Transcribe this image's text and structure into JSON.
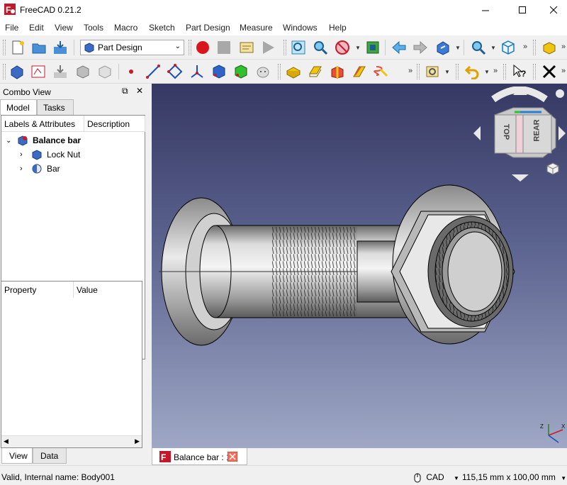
{
  "window": {
    "title": "FreeCAD 0.21.2"
  },
  "menu": [
    "File",
    "Edit",
    "View",
    "Tools",
    "Macro",
    "Sketch",
    "Part Design",
    "Measure",
    "Windows",
    "Help"
  ],
  "toolbar": {
    "workbench": "Part Design"
  },
  "combo_view": {
    "title": "Combo View",
    "tabs": [
      "Model",
      "Tasks"
    ],
    "tree_headers": [
      "Labels & Attributes",
      "Description"
    ],
    "tree": {
      "root": "Balance bar",
      "children": [
        "Lock Nut",
        "Bar"
      ]
    },
    "property_headers": [
      "Property",
      "Value"
    ],
    "bottom_tabs": [
      "View",
      "Data"
    ]
  },
  "document_tab": {
    "label": "Balance bar : 1"
  },
  "navcube": {
    "face_top": "TOP",
    "face_rear": "REAR"
  },
  "status": {
    "message": "Valid, Internal name: Body001",
    "nav_style": "CAD",
    "dimensions": "115,15 mm x 100,00 mm"
  },
  "colors": {
    "viewport_top": "#353862",
    "viewport_bottom": "#a0a8c6",
    "accent": "#1a73c8"
  }
}
